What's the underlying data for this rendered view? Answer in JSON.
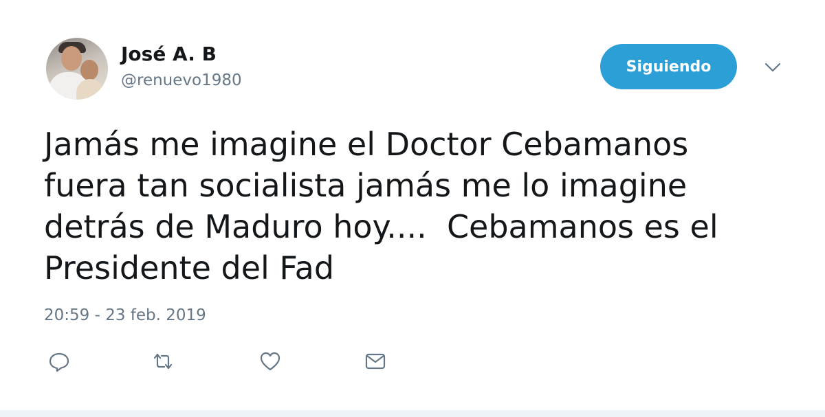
{
  "user": {
    "display_name": "José A. B",
    "handle": "@renuevo1980"
  },
  "follow_button": {
    "label": "Siguiendo",
    "color": "#2d9fd7"
  },
  "menu": {
    "icon": "chevron-down-icon"
  },
  "tweet": {
    "text": "Jamás me imagine el Doctor Cebamanos\nfuera tan socialista jamás me lo imagine\ndetrás de Maduro hoy....  Cebamanos es el\nPresidente del Fad",
    "timestamp": "20:59 - 23 feb. 2019"
  },
  "actions": [
    {
      "icon": "reply-icon"
    },
    {
      "icon": "retweet-icon"
    },
    {
      "icon": "like-icon"
    },
    {
      "icon": "message-icon"
    }
  ],
  "colors": {
    "text": "#14171a",
    "secondary": "#657786",
    "accent": "#2d9fd7"
  }
}
